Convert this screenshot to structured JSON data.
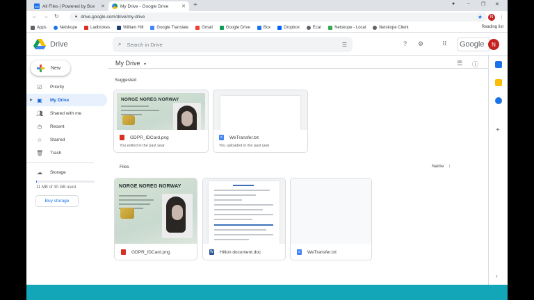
{
  "browser": {
    "tabs": [
      {
        "title": "All Files | Powered by Box",
        "favicon": "box-icon",
        "close": "✕"
      },
      {
        "title": "My Drive - Google Drive",
        "favicon": "drive-icon",
        "close": "✕"
      }
    ],
    "new_tab": "+",
    "url": "drive.google.com/drive/my-drive",
    "profile_initial": "N",
    "bookmarks": [
      "Apps",
      "Netskope",
      "Ladbrokes",
      "William Hill",
      "Google Translate",
      "Gmail",
      "Google Drive",
      "Box",
      "Dropbox",
      "Ecar",
      "Netskope - Local",
      "Netskope Client"
    ],
    "reading_list": "Reading list"
  },
  "header": {
    "app_name": "Drive",
    "search_placeholder": "Search in Drive",
    "brand": "Google",
    "avatar_initial": "N"
  },
  "sidebar": {
    "new_label": "New",
    "items": [
      {
        "label": "Priority",
        "icon": "check-circle-icon",
        "selected": false
      },
      {
        "label": "My Drive",
        "icon": "drive-folder-icon",
        "selected": true
      },
      {
        "label": "Shared with me",
        "icon": "people-icon",
        "selected": false
      },
      {
        "label": "Recent",
        "icon": "clock-icon",
        "selected": false
      },
      {
        "label": "Starred",
        "icon": "star-icon",
        "selected": false
      },
      {
        "label": "Trash",
        "icon": "trash-icon",
        "selected": false
      }
    ],
    "storage_label": "Storage",
    "storage_used_text": "11 MB of 30 GB used",
    "storage_fraction": 0.0004,
    "buy_storage": "Buy storage"
  },
  "main": {
    "title": "My Drive",
    "suggested_label": "Suggested",
    "suggested": [
      {
        "name": "GDPR_IDCard.png",
        "type": "img",
        "sub": "You edited in the past year"
      },
      {
        "name": "WeTransfer.txt",
        "type": "txt",
        "sub": "You uploaded in the past year"
      }
    ],
    "files_label": "Files",
    "sort_label": "Name",
    "sort_arrow": "↑",
    "files": [
      {
        "name": "GDPR_IDCard.png",
        "type": "img"
      },
      {
        "name": "Hilton document.doc",
        "type": "doc"
      },
      {
        "name": "WeTransfer.txt",
        "type": "txt"
      }
    ],
    "idcard_header": "NORGE NOREG NORWAY"
  },
  "colors": {
    "accent": "#1a73e8",
    "selected_bg": "#e8f0fe",
    "band": "#13a6b8",
    "avatar": "#c5221f"
  }
}
